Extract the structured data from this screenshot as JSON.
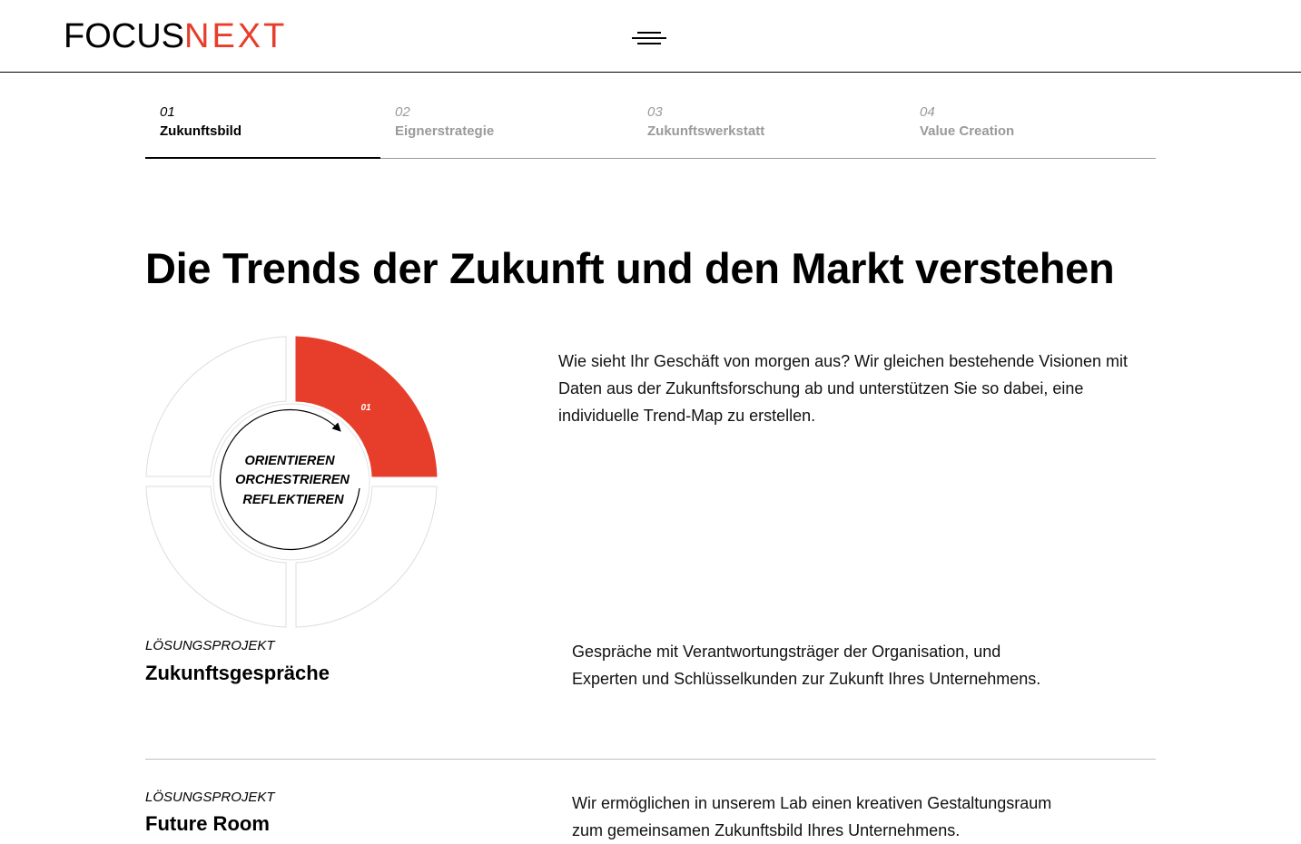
{
  "header": {
    "logo_focus": "FOCUS",
    "logo_next": "NEXT",
    "menu_icon": "hamburger-menu-icon"
  },
  "tabs": [
    {
      "num": "01",
      "label": "Zukunftsbild",
      "active": true
    },
    {
      "num": "02",
      "label": "Eignerstrategie",
      "active": false
    },
    {
      "num": "03",
      "label": "Zukunftswerkstatt",
      "active": false
    },
    {
      "num": "04",
      "label": "Value Creation",
      "active": false
    }
  ],
  "page_title": "Die Trends der Zukunft und den Markt verstehen",
  "diagram": {
    "segment_label": "01",
    "center_lines": [
      "ORIENTIEREN",
      "ORCHESTRIEREN",
      "REFLEKTIEREN"
    ],
    "accent": "#e63e2b"
  },
  "intro_text": "Wie sieht Ihr Geschäft von morgen aus? Wir gleichen bestehende Visionen mit Daten aus der Zukunftsforschung ab und unterstützen Sie so dabei, eine individuelle Trend-Map zu erstellen.",
  "projects": [
    {
      "kicker": "LÖSUNGSPROJEKT",
      "title": "Zukunftsgespräche",
      "description": "Gespräche mit Verantwortungsträger der Organisation, und Experten und Schlüsselkunden zur Zukunft Ihres Unternehmens."
    },
    {
      "kicker": "LÖSUNGSPROJEKT",
      "title": "Future Room",
      "description": "Wir ermöglichen in unserem Lab einen kreativen Gestaltungsraum zum gemeinsamen Zukunftsbild Ihres Unternehmens."
    }
  ]
}
